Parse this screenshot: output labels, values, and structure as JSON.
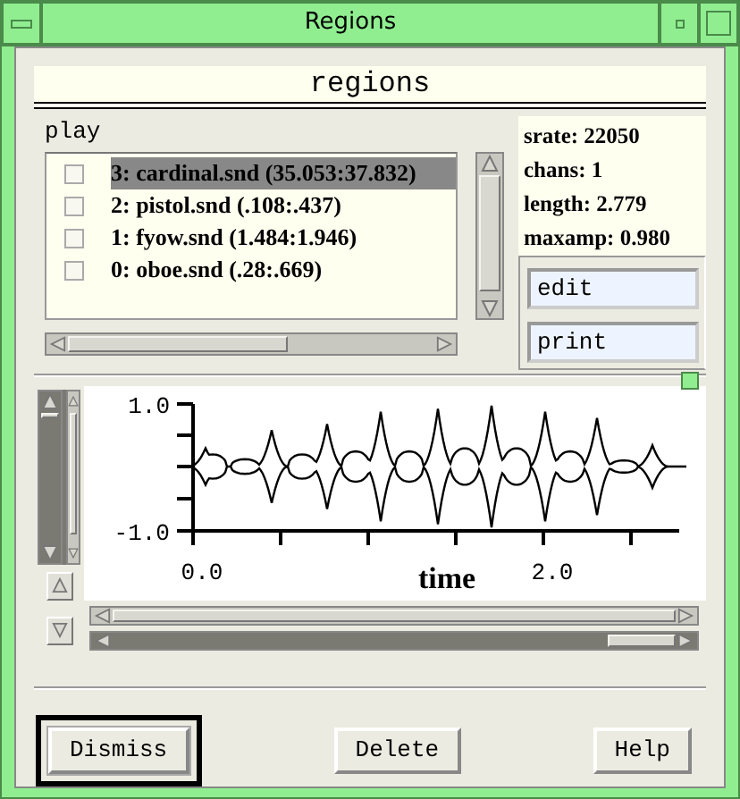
{
  "window": {
    "title": "Regions"
  },
  "header": "regions",
  "play_label": "play",
  "regions": [
    {
      "label": "3: cardinal.snd (35.053:37.832)",
      "checked": false,
      "selected": true
    },
    {
      "label": "2: pistol.snd (.108:.437)",
      "checked": false,
      "selected": false
    },
    {
      "label": "1: fyow.snd (1.484:1.946)",
      "checked": false,
      "selected": false
    },
    {
      "label": "0: oboe.snd (.28:.669)",
      "checked": false,
      "selected": false
    }
  ],
  "info": [
    "srate: 22050",
    "chans: 1",
    "length: 2.779",
    "maxamp: 0.980"
  ],
  "side_buttons": [
    "edit",
    "print"
  ],
  "graph": {
    "yticks": [
      "1.0",
      "-1.0"
    ],
    "xticks": [
      "0.0",
      "2.0"
    ],
    "xlabel": "time"
  },
  "buttons": [
    {
      "label": "Dismiss",
      "default": true
    },
    {
      "label": "Delete",
      "default": false
    },
    {
      "label": "Help",
      "default": false
    }
  ]
}
